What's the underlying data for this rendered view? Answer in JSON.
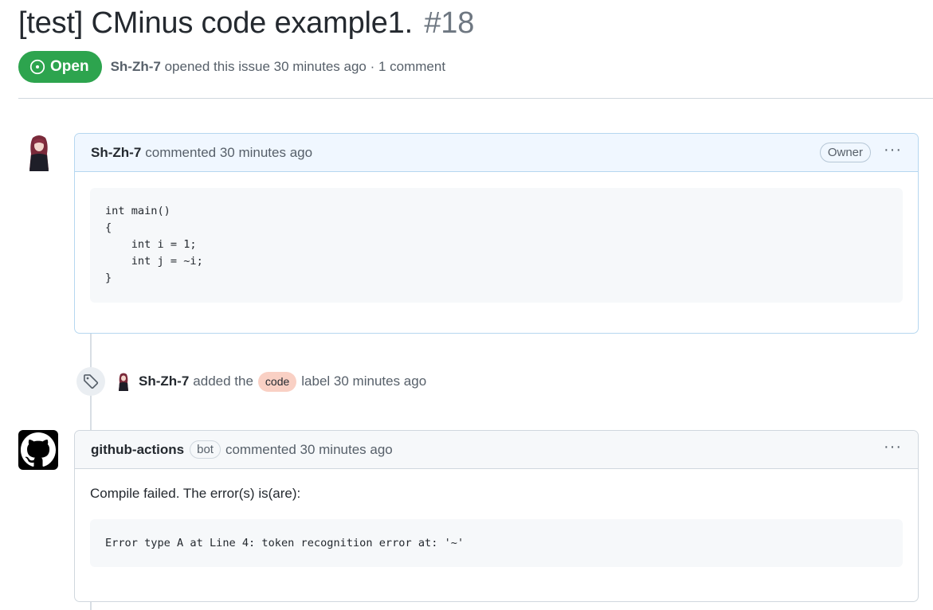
{
  "issue": {
    "title": "[test] CMinus code example1.",
    "number": "#18",
    "state": "Open",
    "author": "Sh-Zh-7",
    "opened_text": "opened this issue 30 minutes ago · 1 comment"
  },
  "comments": [
    {
      "author": "Sh-Zh-7",
      "action": "commented 30 minutes ago",
      "badge": "Owner",
      "more": "···",
      "code_lines": [
        "int main()",
        "{",
        "    int i = 1;",
        "    int j = ~i;",
        "}"
      ]
    },
    {
      "author": "github-actions",
      "bot_badge": "bot",
      "action": "commented 30 minutes ago",
      "more": "···",
      "text": "Compile failed. The error(s) is(are):",
      "code": "Error type A at Line 4: token recognition error at: '~'"
    }
  ],
  "event": {
    "author": "Sh-Zh-7",
    "text_before": "added the",
    "label": "code",
    "text_after": "label 30 minutes ago",
    "label_color": "#f9d0c4"
  },
  "colors": {
    "open_green": "#2da44e",
    "owner_header_bg": "#f0f7ff",
    "code_bg": "#f6f8fa"
  },
  "icons": {
    "state": "issue-opened-icon",
    "event": "tag-icon",
    "bot_avatar": "github-logo-icon"
  }
}
